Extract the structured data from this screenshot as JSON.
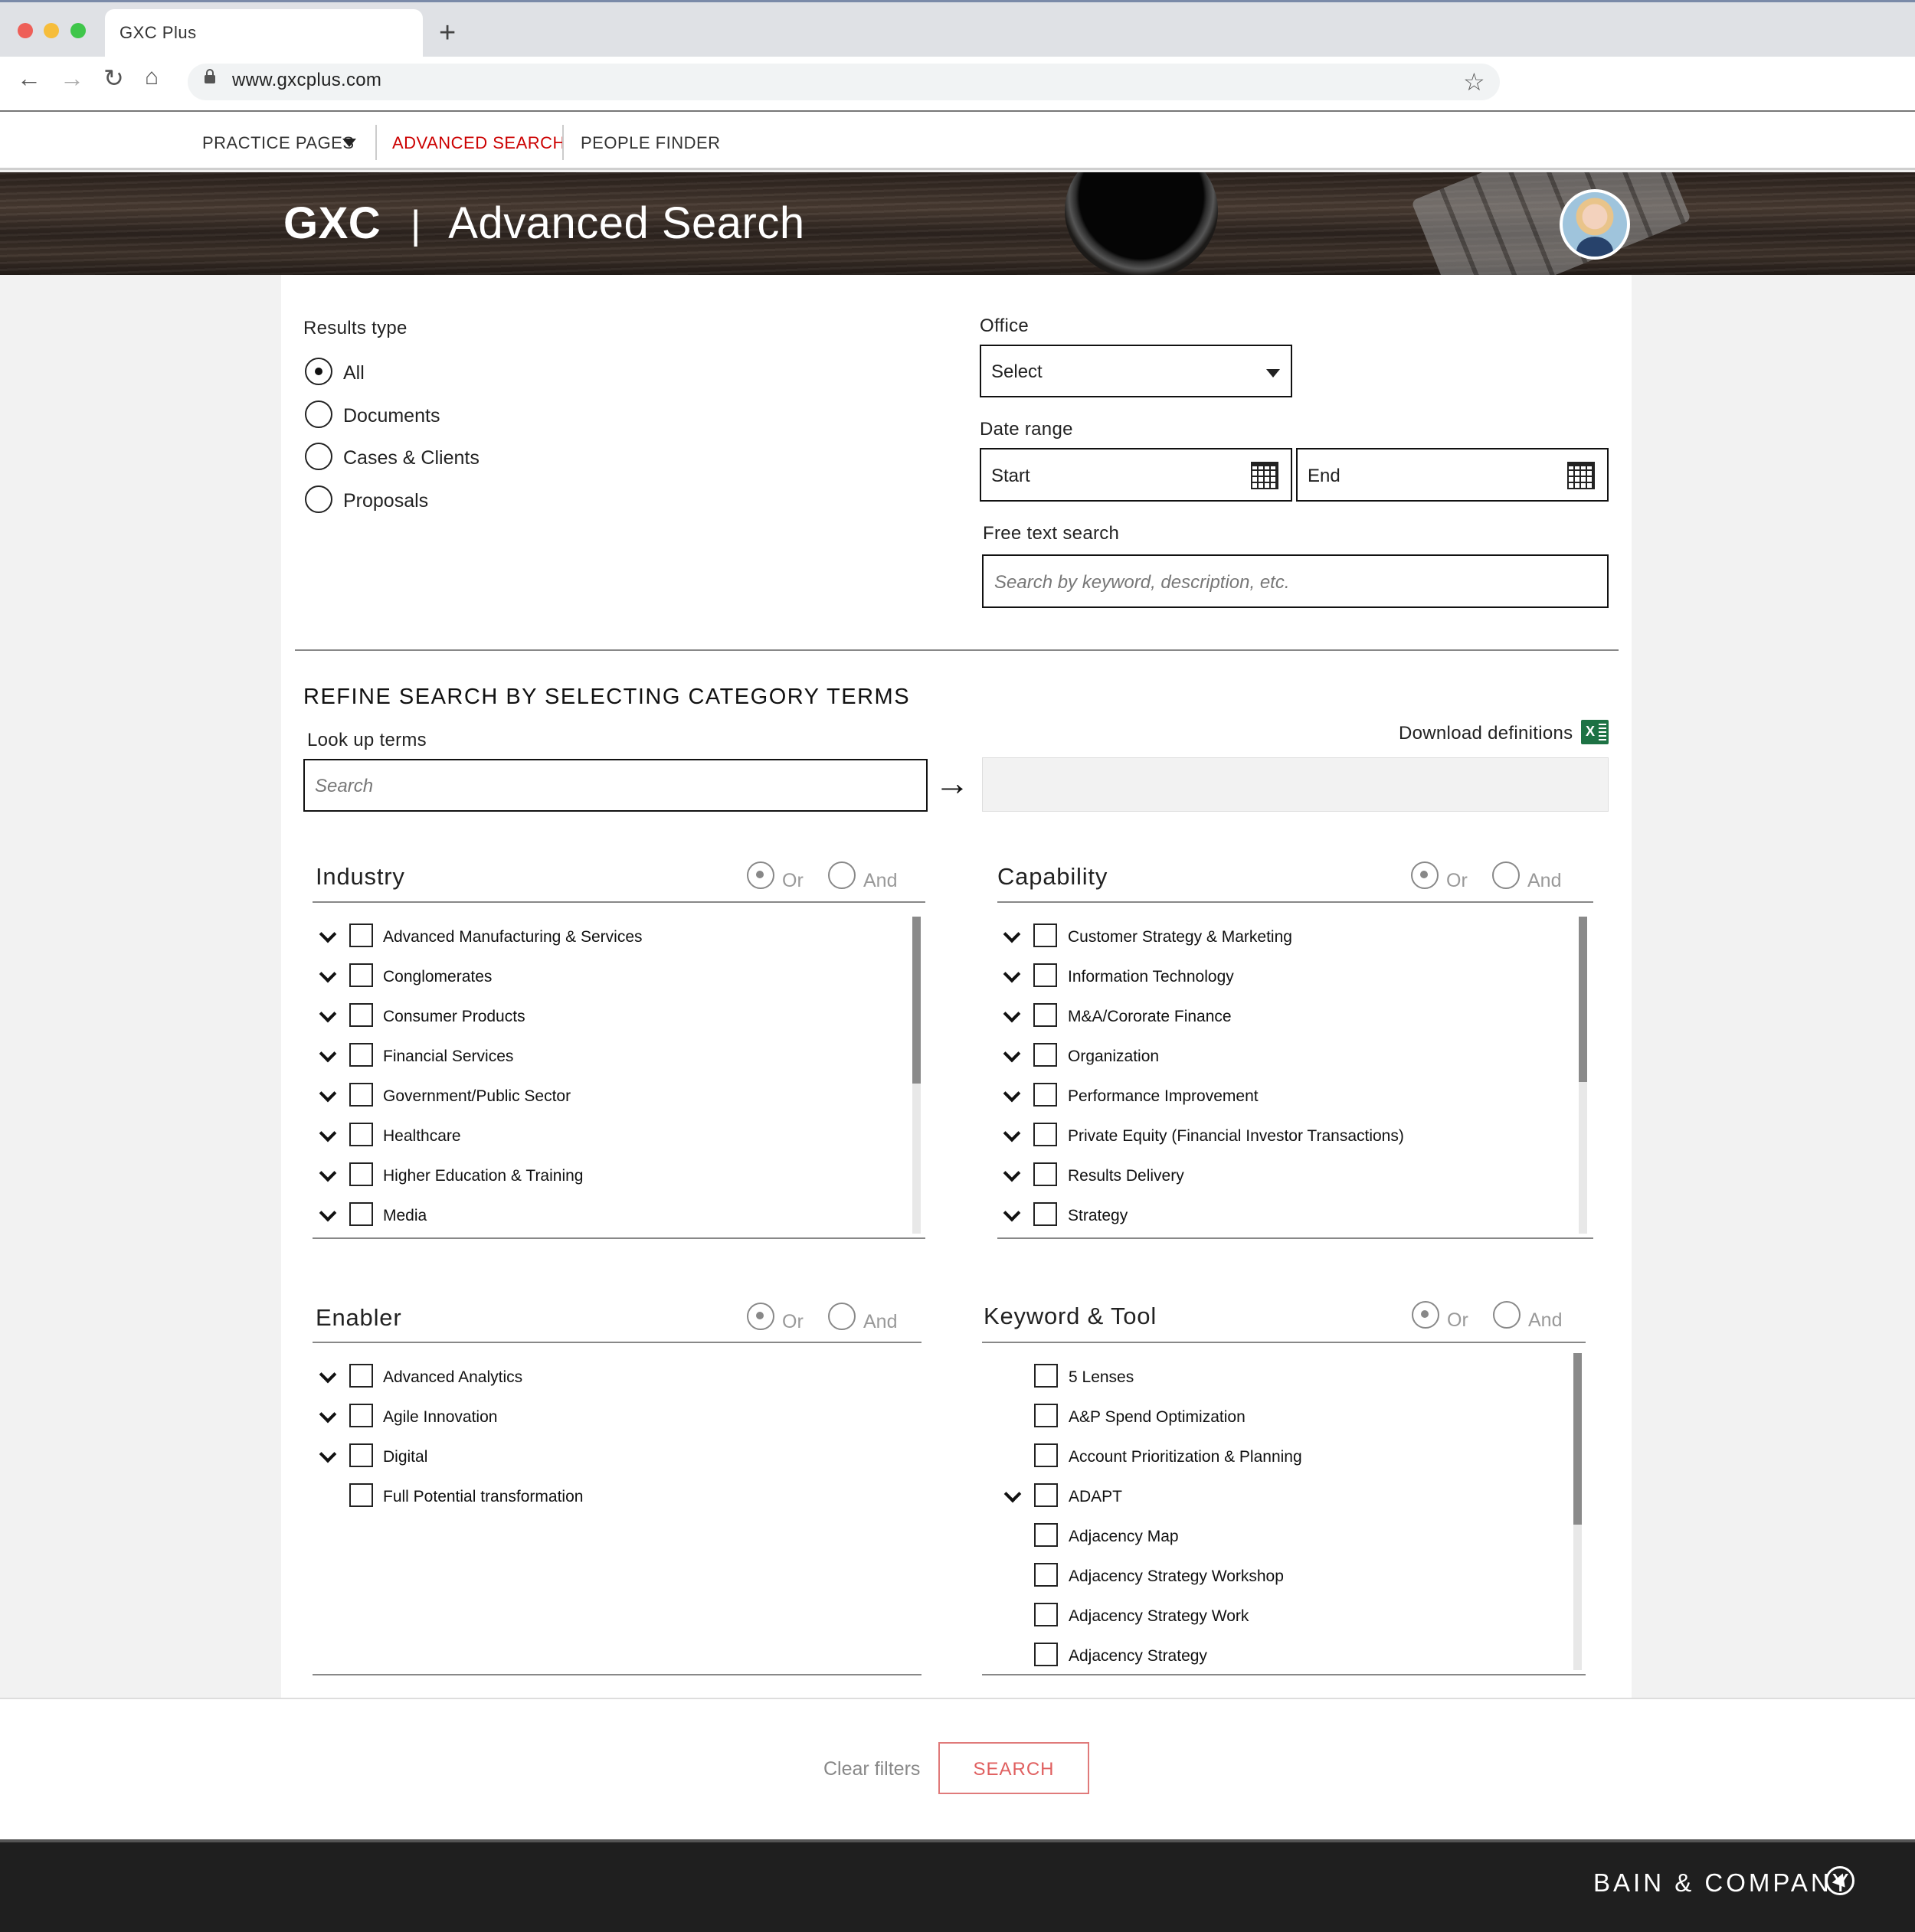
{
  "browser": {
    "tab_title": "GXC Plus",
    "new_tab_icon": "plus-icon",
    "url": "www.gxcplus.com"
  },
  "site_nav": {
    "practice_pages": "PRACTICE PAGES",
    "advanced_search": "ADVANCED SEARCH",
    "people_finder": "PEOPLE FINDER",
    "active_color": "#cc0000"
  },
  "hero": {
    "brand": "GXC",
    "separator": "|",
    "title": "Advanced Search"
  },
  "results_type": {
    "label": "Results type",
    "options": [
      "All",
      "Documents",
      "Cases & Clients",
      "Proposals"
    ],
    "selected": "All"
  },
  "office": {
    "label": "Office",
    "value": "Select"
  },
  "date_range": {
    "label": "Date range",
    "start_placeholder": "Start",
    "end_placeholder": "End"
  },
  "free_text": {
    "label": "Free text search",
    "placeholder": "Search by keyword, description, etc."
  },
  "refine": {
    "title": "REFINE SEARCH BY SELECTING CATEGORY TERMS",
    "lookup_label": "Look up terms",
    "lookup_placeholder": "Search",
    "download_label": "Download definitions",
    "download_icon_text": "X"
  },
  "logic": {
    "or": "Or",
    "and": "And"
  },
  "categories": {
    "industry": {
      "title": "Industry",
      "selected_logic": "Or",
      "items": [
        "Advanced Manufacturing & Services",
        "Conglomerates",
        "Consumer Products",
        "Financial Services",
        "Government/Public Sector",
        "Healthcare",
        "Higher Education & Training",
        "Media"
      ]
    },
    "capability": {
      "title": "Capability",
      "selected_logic": "Or",
      "items": [
        "Customer Strategy & Marketing",
        "Information Technology",
        "M&A/Cororate Finance",
        "Organization",
        "Performance Improvement",
        "Private Equity (Financial Investor Transactions)",
        "Results Delivery",
        "Strategy"
      ]
    },
    "enabler": {
      "title": "Enabler",
      "selected_logic": "Or",
      "items": [
        "Advanced Analytics",
        "Agile Innovation",
        "Digital",
        "Full Potential transformation"
      ]
    },
    "keyword_tool": {
      "title": "Keyword & Tool",
      "selected_logic": "Or",
      "items": [
        "5 Lenses",
        "A&P Spend Optimization",
        "Account Prioritization & Planning",
        "ADAPT",
        "Adjacency Map",
        "Adjacency Strategy Workshop",
        "Adjacency Strategy Work",
        "Adjacency Strategy"
      ]
    }
  },
  "actions": {
    "clear": "Clear filters",
    "search": "SEARCH"
  },
  "footer": {
    "brand": "BAIN & COMPANY"
  }
}
